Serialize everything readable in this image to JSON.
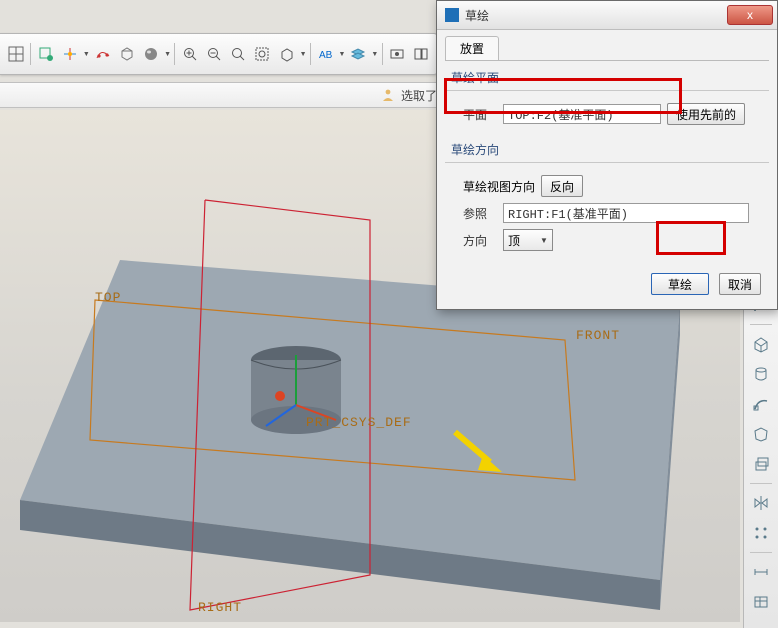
{
  "dialog": {
    "title": "草绘",
    "close_glyph": "x",
    "tab_place": "放置",
    "group_plane_title": "草绘平面",
    "plane_label": "平面",
    "plane_value": "TOP:F2(基准平面)",
    "use_prev_label": "使用先前的",
    "group_dir_title": "草绘方向",
    "view_dir_label": "草绘视图方向",
    "reverse_label": "反向",
    "ref_label": "参照",
    "ref_value": "RIGHT:F1(基准平面)",
    "orient_label": "方向",
    "orient_value": "顶",
    "sketch_btn": "草绘",
    "cancel_btn": "取消"
  },
  "status": {
    "prompt": "选取了"
  },
  "viewport": {
    "label_top": "TOP",
    "label_front": "FRONT",
    "label_right": "RIGHT",
    "label_csys": "PRT_CSYS_DEF"
  },
  "toolbar": {
    "items": [
      "t1",
      "t2",
      "t3",
      "t4",
      "t5",
      "t6",
      "t7",
      "t8",
      "t9",
      "t10",
      "t11",
      "t12",
      "t13",
      "t14",
      "t15",
      "t16"
    ]
  },
  "right_toolbar": {
    "items": [
      "r1",
      "r2",
      "r3",
      "r4",
      "r5",
      "r6",
      "r7",
      "r8",
      "r9",
      "r10",
      "r11"
    ]
  }
}
